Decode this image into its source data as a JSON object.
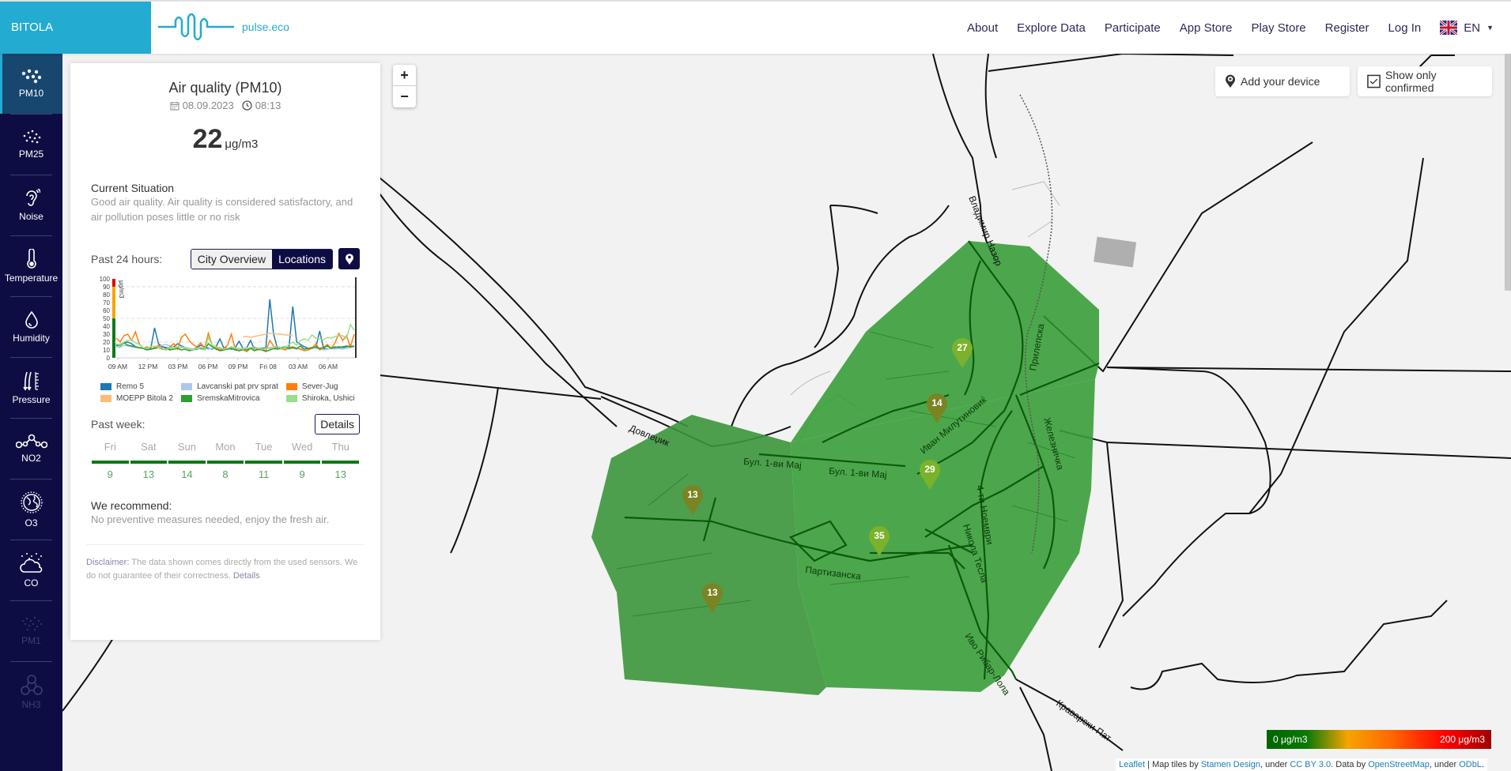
{
  "header": {
    "city": "BITOLA",
    "brand": "pulse.eco",
    "nav": [
      "About",
      "Explore Data",
      "Participate",
      "App Store",
      "Play Store",
      "Register",
      "Log In"
    ],
    "language": "EN"
  },
  "sidebar": {
    "items": [
      {
        "label": "PM10",
        "icon": "particles-icon",
        "state": "active"
      },
      {
        "label": "PM25",
        "icon": "fine-particles-icon",
        "state": "normal"
      },
      {
        "label": "Noise",
        "icon": "ear-icon",
        "state": "normal"
      },
      {
        "label": "Temperature",
        "icon": "thermometer-icon",
        "state": "normal"
      },
      {
        "label": "Humidity",
        "icon": "droplet-icon",
        "state": "normal"
      },
      {
        "label": "Pressure",
        "icon": "pressure-icon",
        "state": "normal"
      },
      {
        "label": "NO2",
        "icon": "molecule-icon",
        "state": "normal"
      },
      {
        "label": "O3",
        "icon": "globe-icon",
        "state": "normal"
      },
      {
        "label": "CO",
        "icon": "cloud-icon",
        "state": "normal"
      },
      {
        "label": "PM1",
        "icon": "particles-small-icon",
        "state": "disabled"
      },
      {
        "label": "NH3",
        "icon": "nh3-icon",
        "state": "disabled"
      }
    ]
  },
  "panel": {
    "title": "Air quality (PM10)",
    "date": "08.09.2023",
    "time": "08:13",
    "value": "22",
    "unit": "μg/m3",
    "situation_heading": "Current Situation",
    "situation_text": "Good air quality. Air quality is considered satisfactory, and air pollution poses little or no risk",
    "past24_label": "Past 24 hours:",
    "toggle": [
      "City Overview",
      "Locations"
    ],
    "toggle_selected": "Locations",
    "past_week_label": "Past week:",
    "details_button": "Details",
    "week": [
      {
        "day": "Fri",
        "value": "9"
      },
      {
        "day": "Sat",
        "value": "13"
      },
      {
        "day": "Sun",
        "value": "14"
      },
      {
        "day": "Mon",
        "value": "8"
      },
      {
        "day": "Tue",
        "value": "11"
      },
      {
        "day": "Wed",
        "value": "9"
      },
      {
        "day": "Thu",
        "value": "13"
      }
    ],
    "recommend_heading": "We recommend:",
    "recommend_text": "No preventive measures needed, enjoy the fresh air.",
    "disclaimer_key": "Disclaimer:",
    "disclaimer_text": " The data shown comes directly from the used sensors. We do not guarantee of their correctness. ",
    "disclaimer_link": "Details"
  },
  "chart_data": {
    "type": "line",
    "title": "",
    "ylabel": "μg/m3",
    "ylim": [
      0,
      100
    ],
    "yticks": [
      0,
      10,
      20,
      30,
      40,
      50,
      60,
      70,
      80,
      90,
      100
    ],
    "xticks": [
      "09 AM",
      "12 PM",
      "03 PM",
      "06 PM",
      "09 PM",
      "Fri 08",
      "03 AM",
      "06 AM"
    ],
    "threshold_bands": [
      {
        "from": 0,
        "to": 50,
        "color": "#0b7a16"
      },
      {
        "from": 50,
        "to": 90,
        "color": "#f6a400"
      },
      {
        "from": 90,
        "to": 100,
        "color": "#e00000"
      }
    ],
    "series": [
      {
        "name": "Remo 5",
        "color": "#1f77b4",
        "values": [
          15,
          17,
          19,
          20,
          18,
          14,
          13,
          12,
          11,
          12,
          38,
          18,
          14,
          13,
          12,
          14,
          18,
          15,
          13,
          12,
          11,
          13,
          16,
          14,
          12,
          11,
          14,
          24,
          13,
          12,
          11,
          13,
          21,
          12,
          13,
          22,
          11,
          12,
          12,
          13,
          74,
          30,
          12,
          11,
          12,
          13,
          65,
          20,
          17,
          14,
          12,
          12,
          13,
          34,
          12,
          11,
          12,
          13,
          14,
          13,
          14,
          15,
          14
        ]
      },
      {
        "name": "Lavcanski pat prv sprat",
        "color": "#aec7e8",
        "values": [
          14,
          13,
          16,
          15,
          14,
          13,
          12,
          13,
          12,
          11,
          12,
          14,
          16,
          17,
          15,
          13,
          12,
          14,
          13,
          12,
          11,
          12,
          13,
          12,
          11,
          12,
          13,
          12,
          11,
          12,
          13,
          12,
          11,
          12,
          13,
          12,
          11,
          12,
          11,
          12,
          12,
          11,
          12,
          11,
          12,
          11,
          12,
          11,
          12,
          11,
          12,
          13,
          12,
          11,
          10,
          11,
          12,
          11,
          12,
          11,
          12,
          13,
          14
        ]
      },
      {
        "name": "Sever-Jug",
        "color": "#ff7f0e",
        "values": [
          25,
          20,
          28,
          30,
          22,
          33,
          18,
          12,
          14,
          11,
          13,
          16,
          12,
          10,
          14,
          18,
          11,
          26,
          30,
          22,
          17,
          14,
          19,
          12,
          31,
          16,
          13,
          10,
          12,
          16,
          30,
          11,
          9,
          10,
          8,
          12,
          14,
          10,
          11,
          9,
          22,
          15,
          11,
          12,
          10,
          13,
          14,
          12,
          11,
          9,
          10,
          12,
          18,
          10,
          13,
          17,
          12,
          19,
          31,
          22,
          28,
          14,
          30
        ]
      },
      {
        "name": "MOEPP Bitola 2",
        "color": "#ffbb78",
        "values": [
          null,
          null,
          null,
          null,
          null,
          null,
          null,
          null,
          null,
          null,
          null,
          null,
          null,
          null,
          null,
          null,
          null,
          null,
          null,
          null,
          null,
          null,
          null,
          null,
          null,
          null,
          null,
          null,
          null,
          null,
          null,
          null,
          null,
          27,
          27,
          26,
          27,
          28,
          29,
          30,
          31,
          31,
          30,
          30,
          29,
          29,
          29,
          null,
          null,
          null,
          null,
          null,
          null,
          null,
          null,
          null,
          null,
          null,
          null,
          null,
          null,
          null,
          null
        ]
      },
      {
        "name": "SremskaMitrovica",
        "color": "#2ca02c",
        "values": [
          17,
          15,
          19,
          16,
          15,
          14,
          13,
          12,
          10,
          11,
          12,
          13,
          11,
          12,
          10,
          11,
          12,
          10,
          11,
          9,
          10,
          11,
          12,
          10,
          18,
          14,
          11,
          9,
          10,
          11,
          12,
          10,
          9,
          11,
          10,
          12,
          9,
          11,
          10,
          8,
          10,
          12,
          11,
          13,
          14,
          12,
          13,
          12,
          15,
          11,
          12,
          13,
          14,
          12,
          13,
          15,
          12,
          14,
          13,
          14,
          15,
          14,
          15
        ]
      },
      {
        "name": "Shiroka, Ushici",
        "color": "#98df8a",
        "values": [
          18,
          16,
          20,
          22,
          23,
          19,
          17,
          13,
          12,
          14,
          15,
          13,
          12,
          11,
          13,
          12,
          14,
          13,
          12,
          11,
          10,
          12,
          11,
          10,
          26,
          16,
          14,
          13,
          11,
          12,
          14,
          13,
          12,
          11,
          12,
          13,
          14,
          12,
          11,
          12,
          13,
          14,
          15,
          12,
          13,
          17,
          20,
          16,
          22,
          24,
          22,
          29,
          25,
          24,
          23,
          26,
          25,
          27,
          28,
          28,
          25,
          42,
          35
        ]
      }
    ]
  },
  "map": {
    "zoom_in": "+",
    "zoom_out": "−",
    "add_device_label": "Add your device",
    "show_confirmed_label": "Show only confirmed",
    "show_confirmed_checked": true,
    "markers": [
      {
        "value": "27",
        "color": "#7bb22b"
      },
      {
        "value": "14",
        "color": "#7a8423"
      },
      {
        "value": "29",
        "color": "#7bb22b"
      },
      {
        "value": "13",
        "color": "#7a8423"
      },
      {
        "value": "35",
        "color": "#7bb22b"
      },
      {
        "value": "13",
        "color": "#7a8423"
      }
    ],
    "street_labels": [
      "Владимир Назор",
      "Прилепска",
      "Иван Милутиновиќ",
      "Железничка",
      "Бул. 1-ви Мај",
      "Бул. 1-ви Мај",
      "Довлеџик",
      "4-ти Ноември",
      "Никола Тесла",
      "Партизанска",
      "Иво Рибар-Лола",
      "Краварски Пат"
    ],
    "scale_min": "0 μg/m3",
    "scale_max": "200 μg/m3",
    "attribution": {
      "leaflet": "Leaflet",
      "sep1": " | Map tiles by ",
      "stamen": "Stamen Design",
      "sep2": ", under ",
      "ccby": "CC BY 3.0",
      "sep3": ". Data by ",
      "osm": "OpenStreetMap",
      "sep4": ", under ",
      "odbl": "ODbL",
      "end": "."
    }
  }
}
